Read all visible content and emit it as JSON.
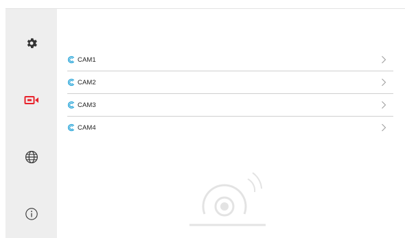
{
  "sidebar": {
    "items": [
      {
        "icon": "gear-icon"
      },
      {
        "icon": "camera-icon",
        "active_color": "#e8222b"
      },
      {
        "icon": "globe-icon"
      },
      {
        "icon": "info-icon"
      }
    ]
  },
  "cameras": [
    {
      "label": "CAM1",
      "icon": "camera-brand-icon"
    },
    {
      "label": "CAM2",
      "icon": "camera-brand-icon"
    },
    {
      "label": "CAM3",
      "icon": "camera-brand-icon"
    },
    {
      "label": "CAM4",
      "icon": "camera-brand-icon"
    }
  ],
  "colors": {
    "sidebar_bg": "#eeeeee",
    "accent_red": "#e8222b",
    "brand_icon": "#1a9fd6",
    "divider": "#cfcfcf"
  }
}
